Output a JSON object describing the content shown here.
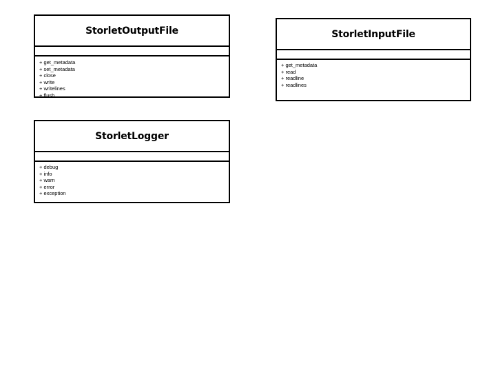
{
  "classes": [
    {
      "name": "StorletOutputFile",
      "operations": [
        "+ get_metadata",
        "+ set_metadata",
        "+ close",
        "+ write",
        "+ writelines",
        "+ flush"
      ]
    },
    {
      "name": "StorletInputFile",
      "operations": [
        "+ get_metadata",
        "+ read",
        "+ readline",
        "+ readlines"
      ]
    },
    {
      "name": "StorletLogger",
      "operations": [
        "+ debug",
        "+ info",
        "+ warn",
        "+ error",
        "+ exception"
      ]
    }
  ]
}
